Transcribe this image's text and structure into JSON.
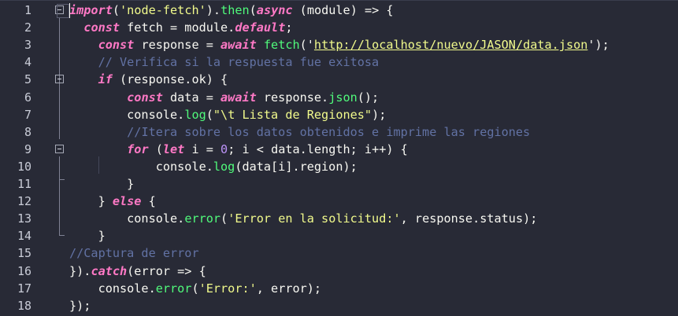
{
  "editor": {
    "line_numbers": [
      "1",
      "2",
      "3",
      "4",
      "5",
      "6",
      "7",
      "8",
      "9",
      "10",
      "11",
      "12",
      "13",
      "14",
      "15",
      "16",
      "17",
      "18"
    ],
    "lines": [
      [
        {
          "t": "import",
          "c": "kw"
        },
        {
          "t": "(",
          "c": "sep"
        },
        {
          "t": "'node-fetch'",
          "c": "str"
        },
        {
          "t": ").",
          "c": "sep"
        },
        {
          "t": "then",
          "c": "fn"
        },
        {
          "t": "(",
          "c": "sep"
        },
        {
          "t": "async",
          "c": "kw"
        },
        {
          "t": " (",
          "c": "sep"
        },
        {
          "t": "module",
          "c": "var"
        },
        {
          "t": ") => {",
          "c": "sep"
        }
      ],
      [
        {
          "t": "  ",
          "c": "sep"
        },
        {
          "t": "const",
          "c": "kw"
        },
        {
          "t": " fetch = module.",
          "c": "var"
        },
        {
          "t": "default",
          "c": "kw"
        },
        {
          "t": ";",
          "c": "sep"
        }
      ],
      [
        {
          "t": "    ",
          "c": "sep"
        },
        {
          "t": "const",
          "c": "kw"
        },
        {
          "t": " response = ",
          "c": "var"
        },
        {
          "t": "await",
          "c": "kw"
        },
        {
          "t": " ",
          "c": "sep"
        },
        {
          "t": "fetch",
          "c": "fn"
        },
        {
          "t": "('",
          "c": "sep"
        },
        {
          "t": "http://localhost/nuevo/JASON/data.json",
          "c": "url"
        },
        {
          "t": "');",
          "c": "sep"
        }
      ],
      [
        {
          "t": "    ",
          "c": "sep"
        },
        {
          "t": "// Verifica si la respuesta fue exitosa",
          "c": "cm"
        }
      ],
      [
        {
          "t": "    ",
          "c": "sep"
        },
        {
          "t": "if",
          "c": "kw"
        },
        {
          "t": " (response.ok) {",
          "c": "var"
        }
      ],
      [
        {
          "t": "        ",
          "c": "sep"
        },
        {
          "t": "const",
          "c": "kw"
        },
        {
          "t": " data = ",
          "c": "var"
        },
        {
          "t": "await",
          "c": "kw"
        },
        {
          "t": " response.",
          "c": "var"
        },
        {
          "t": "json",
          "c": "fn"
        },
        {
          "t": "();",
          "c": "sep"
        }
      ],
      [
        {
          "t": "        console.",
          "c": "var"
        },
        {
          "t": "log",
          "c": "fn"
        },
        {
          "t": "(",
          "c": "sep"
        },
        {
          "t": "\"\\t Lista de Regiones\"",
          "c": "str"
        },
        {
          "t": ");",
          "c": "sep"
        }
      ],
      [
        {
          "t": "        ",
          "c": "sep"
        },
        {
          "t": "//Itera sobre los datos obtenidos e imprime las regiones",
          "c": "cm"
        }
      ],
      [
        {
          "t": "        ",
          "c": "sep"
        },
        {
          "t": "for",
          "c": "kw"
        },
        {
          "t": " (",
          "c": "sep"
        },
        {
          "t": "let",
          "c": "kw"
        },
        {
          "t": " i = ",
          "c": "var"
        },
        {
          "t": "0",
          "c": "num"
        },
        {
          "t": "; i < data.length; i++) {",
          "c": "var"
        }
      ],
      [
        {
          "t": "            console.",
          "c": "var"
        },
        {
          "t": "log",
          "c": "fn"
        },
        {
          "t": "(data[i].region);",
          "c": "var"
        }
      ],
      [
        {
          "t": "        }",
          "c": "sep"
        }
      ],
      [
        {
          "t": "    } ",
          "c": "sep"
        },
        {
          "t": "else",
          "c": "kw"
        },
        {
          "t": " {",
          "c": "sep"
        }
      ],
      [
        {
          "t": "        console.",
          "c": "var"
        },
        {
          "t": "error",
          "c": "fn"
        },
        {
          "t": "(",
          "c": "sep"
        },
        {
          "t": "'Error en la solicitud:'",
          "c": "str"
        },
        {
          "t": ", response.status);",
          "c": "var"
        }
      ],
      [
        {
          "t": "    }",
          "c": "sep"
        }
      ],
      [
        {
          "t": "//Captura de error",
          "c": "cm"
        }
      ],
      [
        {
          "t": "}).",
          "c": "sep"
        },
        {
          "t": "catch",
          "c": "kw"
        },
        {
          "t": "(error => {",
          "c": "var"
        }
      ],
      [
        {
          "t": "    console.",
          "c": "var"
        },
        {
          "t": "error",
          "c": "fn"
        },
        {
          "t": "(",
          "c": "sep"
        },
        {
          "t": "'Error:'",
          "c": "str"
        },
        {
          "t": ", error);",
          "c": "var"
        }
      ],
      [
        {
          "t": "});",
          "c": "sep"
        }
      ]
    ],
    "fold_markers": [
      1,
      5,
      9
    ],
    "colors": {
      "background": "#282a36",
      "keyword": "#ff79c6",
      "function": "#50fa7b",
      "string": "#f1fa8c",
      "comment": "#6272a4",
      "number": "#bd93f9",
      "text": "#f8f8f2"
    }
  }
}
